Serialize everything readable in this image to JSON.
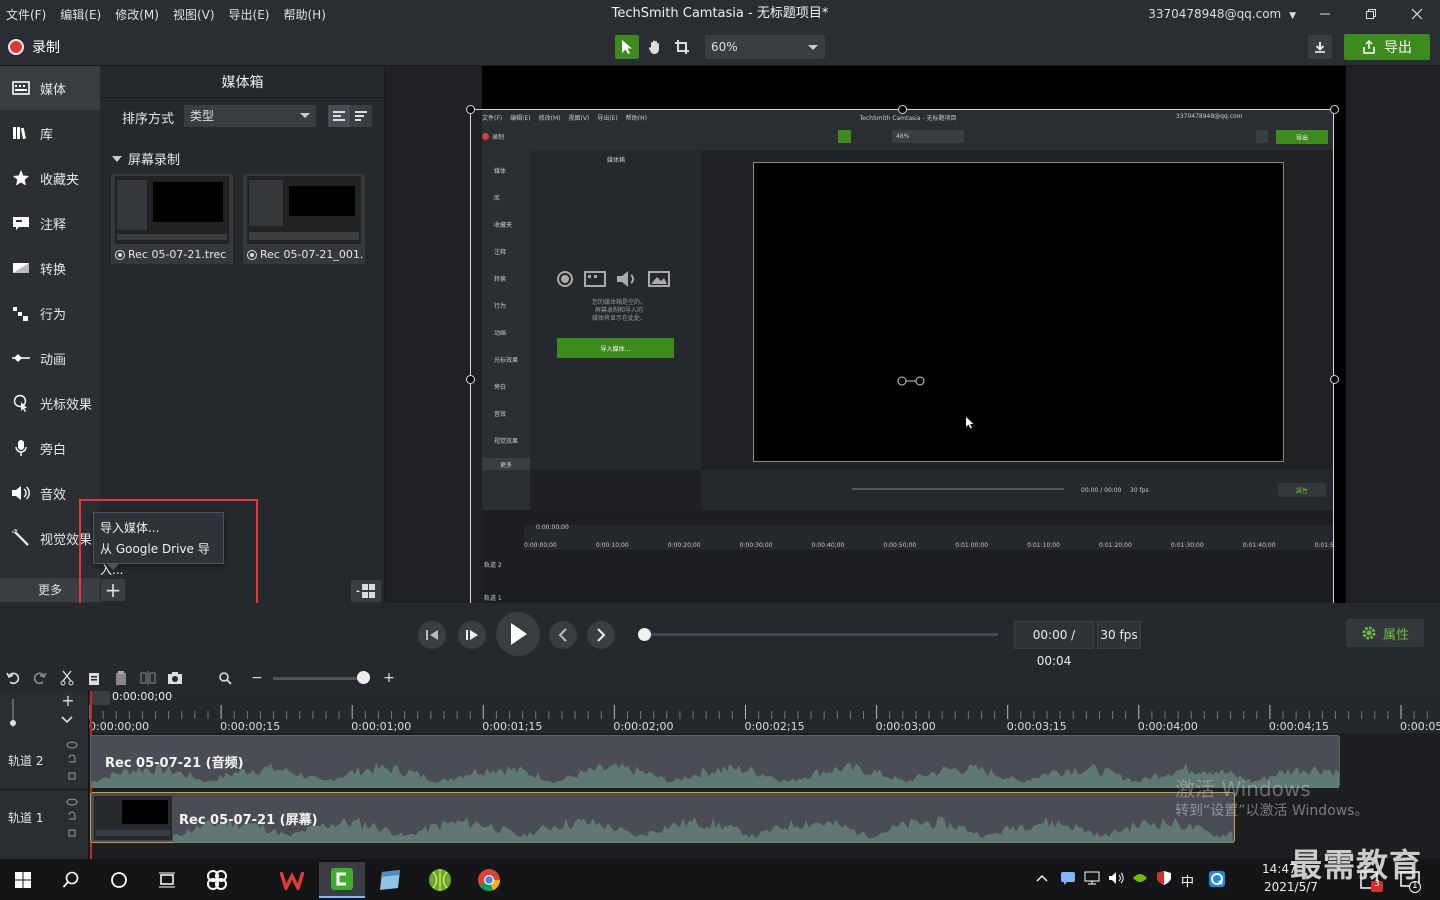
{
  "window": {
    "menu": [
      "文件(F)",
      "编辑(E)",
      "修改(M)",
      "视图(V)",
      "导出(E)",
      "帮助(H)"
    ],
    "title": "TechSmith Camtasia - 无标题项目*",
    "account": "3370478948@qq.com"
  },
  "toolbar": {
    "record_label": "录制",
    "zoom_value": "60%",
    "export_label": "导出"
  },
  "sidebar": {
    "items": [
      {
        "label": "媒体",
        "icon": "media-icon"
      },
      {
        "label": "库",
        "icon": "library-icon"
      },
      {
        "label": "收藏夹",
        "icon": "star-icon"
      },
      {
        "label": "注释",
        "icon": "annotation-icon"
      },
      {
        "label": "转换",
        "icon": "transition-icon"
      },
      {
        "label": "行为",
        "icon": "behavior-icon"
      },
      {
        "label": "动画",
        "icon": "animation-icon"
      },
      {
        "label": "光标效果",
        "icon": "cursor-effect-icon"
      },
      {
        "label": "旁白",
        "icon": "microphone-icon"
      },
      {
        "label": "音效",
        "icon": "speaker-icon"
      },
      {
        "label": "视觉效果",
        "icon": "magic-wand-icon"
      }
    ],
    "more_label": "更多"
  },
  "media_bin": {
    "title": "媒体箱",
    "sort_label": "排序方式",
    "sort_value": "类型",
    "group_label": "屏幕录制",
    "items": [
      "Rec 05-07-21.trec",
      "Rec 05-07-21_001..."
    ],
    "popup": [
      "导入媒体...",
      "从 Google Drive 导入..."
    ]
  },
  "inner_screen": {
    "menu": [
      "文件(F)",
      "编辑(E)",
      "修改(M)",
      "视图(V)",
      "导出(E)",
      "帮助(H)"
    ],
    "title": "TechSmith Camtasia - 无标题项目",
    "account": "3370478948@qq.com",
    "record": "录制",
    "zoom": "46%",
    "export": "导出",
    "bin_title": "媒体箱",
    "sidebar": [
      "媒体",
      "库",
      "收藏夹",
      "注释",
      "转换",
      "行为",
      "动画",
      "光标效果",
      "旁白",
      "音效",
      "视觉效果"
    ],
    "more": "更多",
    "empty_text_1": "您的媒体箱是空的。",
    "empty_text_2": "屏幕录制和导入的",
    "empty_text_3": "媒体将显示在此处。",
    "import_button": "导入媒体...",
    "time": "00:00 / 00:00",
    "fps": "30 fps",
    "props": "属性",
    "playhead": "0:00:00;00",
    "ticks": [
      "0:00:00;00",
      "0:00:10;00",
      "0:00:20;00",
      "0:00:30;00",
      "0:00:40;00",
      "0:00:50;00",
      "0:01:00;00",
      "0:01:10;00",
      "0:01:20;00",
      "0:01:30;00",
      "0:01:40;00",
      "0:01:5"
    ],
    "tracks": [
      "轨道 2",
      "轨道 1"
    ]
  },
  "playback": {
    "time": "00:00 / 00:04",
    "fps": "30 fps",
    "properties_label": "属性"
  },
  "timeline": {
    "playhead_time": "0:00:00;00",
    "ticks": [
      "0:00:00;00",
      "0:00:00;15",
      "0:00:01;00",
      "0:00:01;15",
      "0:00:02;00",
      "0:00:02;15",
      "0:00:03;00",
      "0:00:03;15",
      "0:00:04;00",
      "0:00:04;15",
      "0:00:05"
    ],
    "tracks": [
      {
        "label": "轨道 2",
        "clip": "Rec 05-07-21 (音频)"
      },
      {
        "label": "轨道 1",
        "clip": "Rec 05-07-21 (屏幕)"
      }
    ]
  },
  "watermark": {
    "line1": "激活 Windows",
    "line2": "转到“设置”以激活 Windows。"
  },
  "taskbar": {
    "ime": "中",
    "time": "14:47",
    "date": "2021/5/7",
    "notify_badge": "3",
    "chat_badge": "1"
  },
  "overlay_brand": "最需教育",
  "colors": {
    "accent_green": "#3c8b1c",
    "record_red": "#e53935",
    "highlight_box": "#e53935"
  }
}
